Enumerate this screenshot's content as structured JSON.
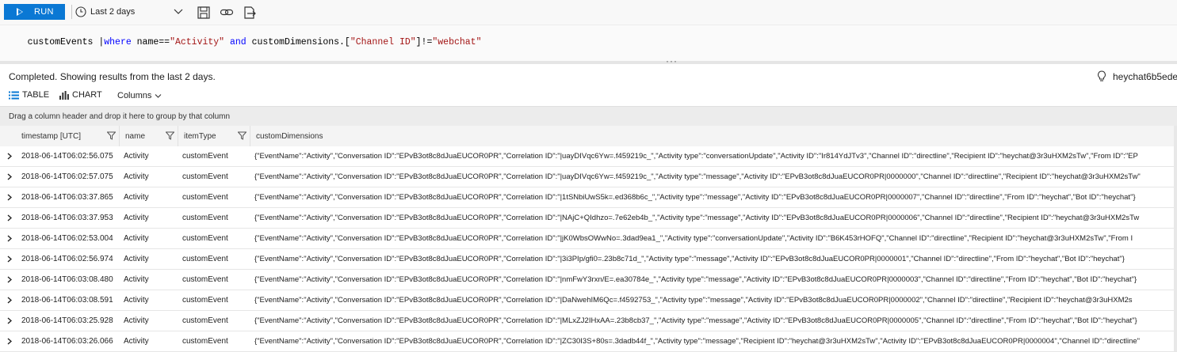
{
  "toolbar": {
    "run_label": "RUN",
    "time_range": "Last 2 days",
    "icons": [
      "clock-icon",
      "save-icon",
      "link-icon",
      "export-icon"
    ]
  },
  "editor": {
    "query_parts": [
      {
        "text": "customEvents |",
        "style": "plain"
      },
      {
        "text": "where",
        "style": "kw"
      },
      {
        "text": " name==",
        "style": "plain"
      },
      {
        "text": "\"Activity\"",
        "style": "str"
      },
      {
        "text": " ",
        "style": "plain"
      },
      {
        "text": "and",
        "style": "kw"
      },
      {
        "text": " customDimensions.[",
        "style": "plain"
      },
      {
        "text": "\"Channel ID\"",
        "style": "str"
      },
      {
        "text": "]!=",
        "style": "plain"
      },
      {
        "text": "\"webchat\"",
        "style": "str"
      }
    ]
  },
  "results": {
    "status": "Completed. Showing results from the last 2 days.",
    "resource_name": "heychat6b5ede"
  },
  "view_tabs": {
    "table_label": "TABLE",
    "chart_label": "CHART",
    "columns_label": "Columns"
  },
  "groupbar": {
    "hint": "Drag a column header and drop it here to group by that column"
  },
  "grid": {
    "headers": [
      "timestamp [UTC]",
      "name",
      "itemType",
      "customDimensions"
    ],
    "rows": [
      {
        "timestamp": "2018-06-14T06:02:56.075",
        "name": "Activity",
        "itemType": "customEvent",
        "customDimensions": "{\"EventName\":\"Activity\",\"Conversation ID\":\"EPvB3ot8c8dJuaEUCOR0PR\",\"Correlation ID\":\"|uayDIVqc6Yw=.f459219c_\",\"Activity type\":\"conversationUpdate\",\"Activity ID\":\"Ir814YdJTv3\",\"Channel ID\":\"directline\",\"Recipient ID\":\"heychat@3r3uHXM2sTw\",\"From ID\":\"EP"
      },
      {
        "timestamp": "2018-06-14T06:02:57.075",
        "name": "Activity",
        "itemType": "customEvent",
        "customDimensions": "{\"EventName\":\"Activity\",\"Conversation ID\":\"EPvB3ot8c8dJuaEUCOR0PR\",\"Correlation ID\":\"|uayDIVqc6Yw=.f459219c_\",\"Activity type\":\"message\",\"Activity ID\":\"EPvB3ot8c8dJuaEUCOR0PR|0000000\",\"Channel ID\":\"directline\",\"Recipient ID\":\"heychat@3r3uHXM2sTw\""
      },
      {
        "timestamp": "2018-06-14T06:03:37.865",
        "name": "Activity",
        "itemType": "customEvent",
        "customDimensions": "{\"EventName\":\"Activity\",\"Conversation ID\":\"EPvB3ot8c8dJuaEUCOR0PR\",\"Correlation ID\":\"|1tSNbiUwS5k=.ed368b6c_\",\"Activity type\":\"message\",\"Activity ID\":\"EPvB3ot8c8dJuaEUCOR0PR|0000007\",\"Channel ID\":\"directline\",\"From ID\":\"heychat\",\"Bot ID\":\"heychat\"}"
      },
      {
        "timestamp": "2018-06-14T06:03:37.953",
        "name": "Activity",
        "itemType": "customEvent",
        "customDimensions": "{\"EventName\":\"Activity\",\"Conversation ID\":\"EPvB3ot8c8dJuaEUCOR0PR\",\"Correlation ID\":\"|NAjC+QIdhzo=.7e62eb4b_\",\"Activity type\":\"message\",\"Activity ID\":\"EPvB3ot8c8dJuaEUCOR0PR|0000006\",\"Channel ID\":\"directline\",\"Recipient ID\":\"heychat@3r3uHXM2sTw"
      },
      {
        "timestamp": "2018-06-14T06:02:53.004",
        "name": "Activity",
        "itemType": "customEvent",
        "customDimensions": "{\"EventName\":\"Activity\",\"Conversation ID\":\"EPvB3ot8c8dJuaEUCOR0PR\",\"Correlation ID\":\"|jK0WbsOWwNo=.3dad9ea1_\",\"Activity type\":\"conversationUpdate\",\"Activity ID\":\"B6K453rHOFQ\",\"Channel ID\":\"directline\",\"Recipient ID\":\"heychat@3r3uHXM2sTw\",\"From I"
      },
      {
        "timestamp": "2018-06-14T06:02:56.974",
        "name": "Activity",
        "itemType": "customEvent",
        "customDimensions": "{\"EventName\":\"Activity\",\"Conversation ID\":\"EPvB3ot8c8dJuaEUCOR0PR\",\"Correlation ID\":\"|3i3PIp/gfi0=.23b8c71d_\",\"Activity type\":\"message\",\"Activity ID\":\"EPvB3ot8c8dJuaEUCOR0PR|0000001\",\"Channel ID\":\"directline\",\"From ID\":\"heychat\",\"Bot ID\":\"heychat\"}"
      },
      {
        "timestamp": "2018-06-14T06:03:08.480",
        "name": "Activity",
        "itemType": "customEvent",
        "customDimensions": "{\"EventName\":\"Activity\",\"Conversation ID\":\"EPvB3ot8c8dJuaEUCOR0PR\",\"Correlation ID\":\"|nmFwY3rxn/E=.ea30784e_\",\"Activity type\":\"message\",\"Activity ID\":\"EPvB3ot8c8dJuaEUCOR0PR|0000003\",\"Channel ID\":\"directline\",\"From ID\":\"heychat\",\"Bot ID\":\"heychat\"}"
      },
      {
        "timestamp": "2018-06-14T06:03:08.591",
        "name": "Activity",
        "itemType": "customEvent",
        "customDimensions": "{\"EventName\":\"Activity\",\"Conversation ID\":\"EPvB3ot8c8dJuaEUCOR0PR\",\"Correlation ID\":\"|DaNwehIM6Qc=.f4592753_\",\"Activity type\":\"message\",\"Activity ID\":\"EPvB3ot8c8dJuaEUCOR0PR|0000002\",\"Channel ID\":\"directline\",\"Recipient ID\":\"heychat@3r3uHXM2s"
      },
      {
        "timestamp": "2018-06-14T06:03:25.928",
        "name": "Activity",
        "itemType": "customEvent",
        "customDimensions": "{\"EventName\":\"Activity\",\"Conversation ID\":\"EPvB3ot8c8dJuaEUCOR0PR\",\"Correlation ID\":\"|MLxZJ2IHxAA=.23b8cb37_\",\"Activity type\":\"message\",\"Activity ID\":\"EPvB3ot8c8dJuaEUCOR0PR|0000005\",\"Channel ID\":\"directline\",\"From ID\":\"heychat\",\"Bot ID\":\"heychat\"}"
      },
      {
        "timestamp": "2018-06-14T06:03:26.066",
        "name": "Activity",
        "itemType": "customEvent",
        "customDimensions": "{\"EventName\":\"Activity\",\"Conversation ID\":\"EPvB3ot8c8dJuaEUCOR0PR\",\"Correlation ID\":\"|ZC30I3S+80s=.3dadb44f_\",\"Activity type\":\"message\",\"Recipient ID\":\"heychat@3r3uHXM2sTw\",\"Activity ID\":\"EPvB3ot8c8dJuaEUCOR0PR|0000004\",\"Channel ID\":\"directline\""
      }
    ]
  },
  "colors": {
    "run_button": "#0a78d4",
    "keyword": "#0000ff",
    "string": "#a31515"
  }
}
